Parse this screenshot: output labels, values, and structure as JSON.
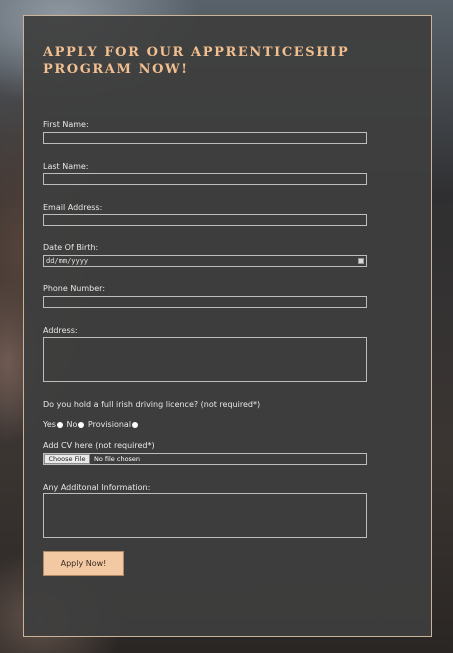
{
  "form": {
    "title": "APPLY FOR OUR APPRENTICESHIP PROGRAM NOW!",
    "first_name_label": "First Name:",
    "last_name_label": "Last Name:",
    "email_label": "Email Address:",
    "dob_label": "Date Of Birth:",
    "dob_placeholder": "dd/mm/yyyy",
    "phone_label": "Phone Number:",
    "address_label": "Address:",
    "licence_question": "Do you hold a full irish driving licence? (not required*)",
    "licence_options": [
      "Yes",
      "No",
      "Provisional"
    ],
    "cv_label": "Add CV here (not required*)",
    "cv_button": "Choose File",
    "cv_status": "No file chosen",
    "info_label": "Any Additonal Information:",
    "submit_label": "Apply Now!"
  },
  "colors": {
    "accent": "#f2bf90",
    "panel_border": "#c9b49a",
    "button_bg": "#f3c9a4"
  },
  "icons": {
    "date_picker": "calendar-icon",
    "radio": "radio-circle"
  }
}
